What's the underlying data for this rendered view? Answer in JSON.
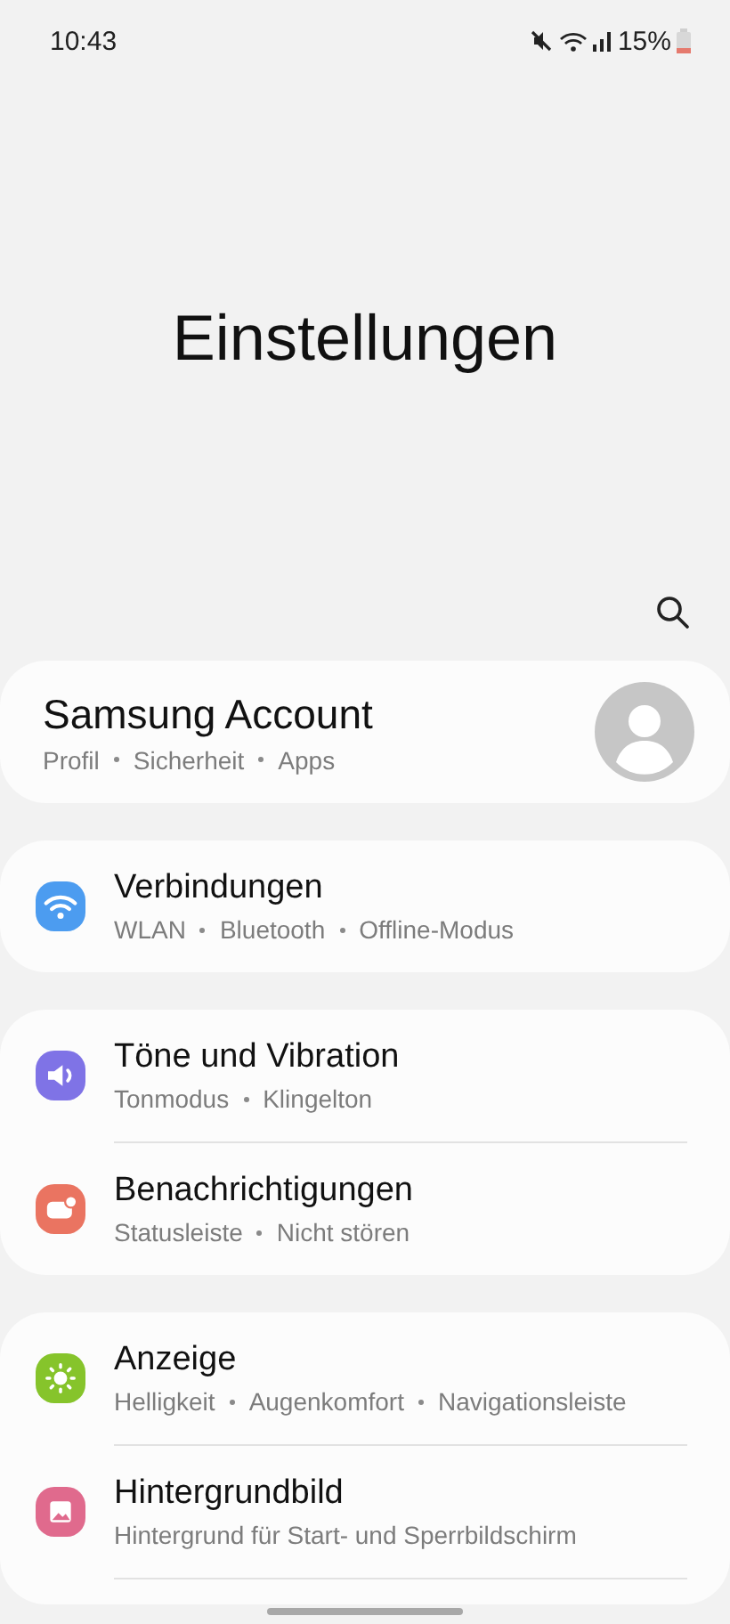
{
  "status_bar": {
    "time": "10:43",
    "battery": "15%"
  },
  "title": "Einstellungen",
  "account": {
    "title": "Samsung Account",
    "subtitle": [
      "Profil",
      "Sicherheit",
      "Apps"
    ]
  },
  "groups": [
    {
      "items": [
        {
          "kind": "wifi",
          "color": "#4c9cf0",
          "title": "Verbindungen",
          "subtitle": [
            "WLAN",
            "Bluetooth",
            "Offline-Modus"
          ]
        }
      ]
    },
    {
      "items": [
        {
          "kind": "sound",
          "color": "#7f73e6",
          "title": "Töne und Vibration",
          "subtitle": [
            "Tonmodus",
            "Klingelton"
          ]
        },
        {
          "kind": "notification",
          "color": "#ea7461",
          "title": "Benachrichtigungen",
          "subtitle": [
            "Statusleiste",
            "Nicht stören"
          ]
        }
      ]
    },
    {
      "items": [
        {
          "kind": "display",
          "color": "#86c42b",
          "title": "Anzeige",
          "subtitle": [
            "Helligkeit",
            "Augenkomfort",
            "Navigationsleiste"
          ]
        },
        {
          "kind": "wallpaper",
          "color": "#e06a8d",
          "title": "Hintergrundbild",
          "subtitle": [
            "Hintergrund für Start- und Sperrbildschirm"
          ]
        }
      ]
    }
  ]
}
